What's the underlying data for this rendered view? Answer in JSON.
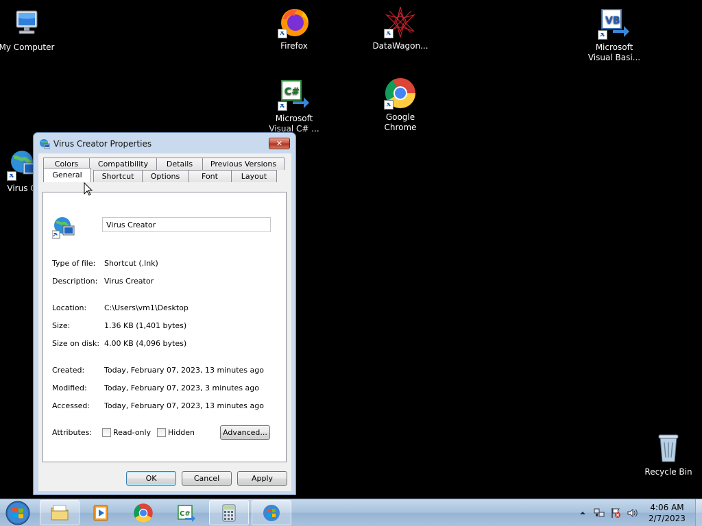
{
  "desktop": {
    "icons": [
      {
        "id": "my-computer",
        "label": "My Computer"
      },
      {
        "id": "firefox",
        "label": "Firefox"
      },
      {
        "id": "datawagon",
        "label": "DataWagon..."
      },
      {
        "id": "vb",
        "label": "Microsoft\nVisual Basi..."
      },
      {
        "id": "csharp",
        "label": "Microsoft\nVisual C# ..."
      },
      {
        "id": "chrome",
        "label": "Google\nChrome"
      },
      {
        "id": "virus",
        "label": "Virus Cr"
      },
      {
        "id": "recycle",
        "label": "Recycle Bin"
      }
    ]
  },
  "dialog": {
    "title": "Virus Creator Properties",
    "close_label": "✕",
    "tabs_row1": [
      "Colors",
      "Compatibility",
      "Details",
      "Previous Versions"
    ],
    "tabs_row2": [
      "General",
      "Shortcut",
      "Options",
      "Font",
      "Layout"
    ],
    "active_tab": "General",
    "name_value": "Virus Creator",
    "type_label": "Type of file:",
    "type_value": "Shortcut (.lnk)",
    "desc_label": "Description:",
    "desc_value": "Virus Creator",
    "location_label": "Location:",
    "location_value": "C:\\Users\\vm1\\Desktop",
    "size_label": "Size:",
    "size_value": "1.36 KB (1,401 bytes)",
    "size_disk_label": "Size on disk:",
    "size_disk_value": "4.00 KB (4,096 bytes)",
    "created_label": "Created:",
    "created_value": "Today, February 07, 2023, 13 minutes ago",
    "modified_label": "Modified:",
    "modified_value": "Today, February 07, 2023, 3 minutes ago",
    "accessed_label": "Accessed:",
    "accessed_value": "Today, February 07, 2023, 13 minutes ago",
    "attributes_label": "Attributes:",
    "readonly_label": "Read-only",
    "hidden_label": "Hidden",
    "advanced_label": "Advanced...",
    "ok_label": "OK",
    "cancel_label": "Cancel",
    "apply_label": "Apply"
  },
  "taskbar": {
    "time": "4:06 AM",
    "date": "2/7/2023"
  },
  "colors": {
    "desktop": "#000000",
    "title_bar": "#c9d9ee",
    "close_button": "#c74b35",
    "taskbar": "#a7c2dd"
  }
}
